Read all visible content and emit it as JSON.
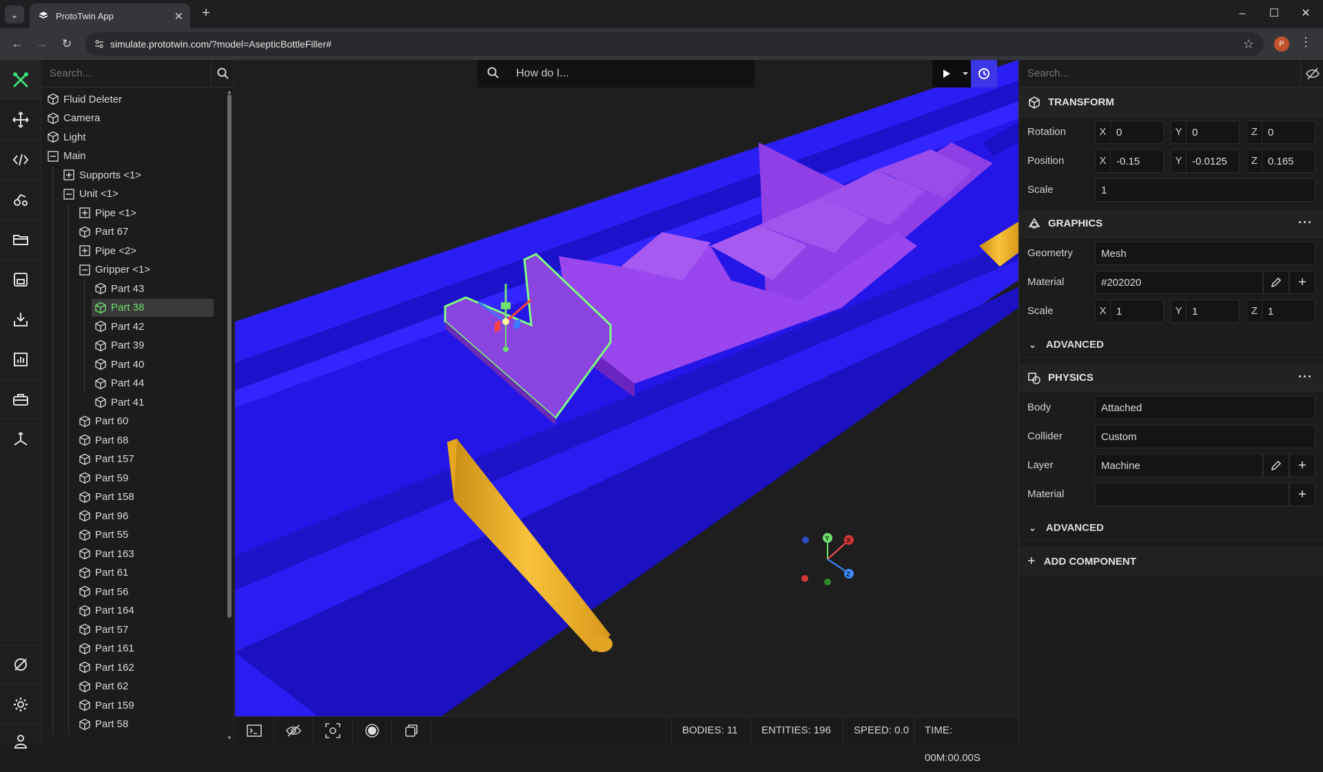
{
  "browser": {
    "tab_title": "ProtoTwin App",
    "url": "simulate.prototwin.com/?model=AsepticBottleFiller#",
    "profile_initial": "P"
  },
  "hierarchy": {
    "search_placeholder": "Search...",
    "items": [
      {
        "label": "Fluid Deleter",
        "level": 0,
        "icon": "cube-icon"
      },
      {
        "label": "Camera",
        "level": 0,
        "icon": "cube-icon"
      },
      {
        "label": "Light",
        "level": 0,
        "icon": "cube-icon"
      },
      {
        "label": "Main",
        "level": 0,
        "icon": "collapse-icon"
      },
      {
        "label": "Supports <1>",
        "level": 1,
        "icon": "expand-icon"
      },
      {
        "label": "Unit <1>",
        "level": 1,
        "icon": "collapse-icon"
      },
      {
        "label": "Pipe <1>",
        "level": 2,
        "icon": "expand-icon"
      },
      {
        "label": "Part 67",
        "level": 2,
        "icon": "cube-icon"
      },
      {
        "label": "Pipe <2>",
        "level": 2,
        "icon": "expand-icon"
      },
      {
        "label": "Gripper <1>",
        "level": 2,
        "icon": "collapse-icon"
      },
      {
        "label": "Part 43",
        "level": 3,
        "icon": "cube-icon"
      },
      {
        "label": "Part 38",
        "level": 3,
        "icon": "cube-icon",
        "selected": true
      },
      {
        "label": "Part 42",
        "level": 3,
        "icon": "cube-icon"
      },
      {
        "label": "Part 39",
        "level": 3,
        "icon": "cube-icon"
      },
      {
        "label": "Part 40",
        "level": 3,
        "icon": "cube-icon"
      },
      {
        "label": "Part 44",
        "level": 3,
        "icon": "cube-icon"
      },
      {
        "label": "Part 41",
        "level": 3,
        "icon": "cube-icon"
      },
      {
        "label": "Part 60",
        "level": 2,
        "icon": "cube-icon"
      },
      {
        "label": "Part 68",
        "level": 2,
        "icon": "cube-icon"
      },
      {
        "label": "Part 157",
        "level": 2,
        "icon": "cube-icon"
      },
      {
        "label": "Part 59",
        "level": 2,
        "icon": "cube-icon"
      },
      {
        "label": "Part 158",
        "level": 2,
        "icon": "cube-icon"
      },
      {
        "label": "Part 96",
        "level": 2,
        "icon": "cube-icon"
      },
      {
        "label": "Part 55",
        "level": 2,
        "icon": "cube-icon"
      },
      {
        "label": "Part 163",
        "level": 2,
        "icon": "cube-icon"
      },
      {
        "label": "Part 61",
        "level": 2,
        "icon": "cube-icon"
      },
      {
        "label": "Part 56",
        "level": 2,
        "icon": "cube-icon"
      },
      {
        "label": "Part 164",
        "level": 2,
        "icon": "cube-icon"
      },
      {
        "label": "Part 57",
        "level": 2,
        "icon": "cube-icon"
      },
      {
        "label": "Part 161",
        "level": 2,
        "icon": "cube-icon"
      },
      {
        "label": "Part 162",
        "level": 2,
        "icon": "cube-icon"
      },
      {
        "label": "Part 62",
        "level": 2,
        "icon": "cube-icon"
      },
      {
        "label": "Part 159",
        "level": 2,
        "icon": "cube-icon"
      },
      {
        "label": "Part 58",
        "level": 2,
        "icon": "cube-icon"
      }
    ]
  },
  "viewport": {
    "search_placeholder": "How do I...",
    "status": {
      "bodies": "BODIES: 11",
      "entities": "ENTITIES: 196",
      "speed": "SPEED: 0.0",
      "time": "TIME: 00M:00.00S"
    },
    "gizmo_labels": {
      "x": "X",
      "y": "Y",
      "z": "Z"
    }
  },
  "inspector": {
    "search_placeholder": "Search...",
    "transform": {
      "title": "TRANSFORM",
      "rotation_label": "Rotation",
      "rotation": {
        "x": "0",
        "y": "0",
        "z": "0"
      },
      "position_label": "Position",
      "position": {
        "x": "-0.15",
        "y": "-0.0125",
        "z": "0.165"
      },
      "scale_label": "Scale",
      "scale": "1"
    },
    "graphics": {
      "title": "GRAPHICS",
      "geometry_label": "Geometry",
      "geometry": "Mesh",
      "material_label": "Material",
      "material": "#202020",
      "scale_label": "Scale",
      "scale": {
        "x": "1",
        "y": "1",
        "z": "1"
      },
      "advanced": "ADVANCED"
    },
    "physics": {
      "title": "PHYSICS",
      "body_label": "Body",
      "body": "Attached",
      "collider_label": "Collider",
      "collider": "Custom",
      "layer_label": "Layer",
      "layer": "Machine",
      "material_label": "Material",
      "material": "",
      "advanced": "ADVANCED"
    },
    "add_component": "ADD COMPONENT"
  },
  "axis_letters": {
    "x": "X",
    "y": "Y",
    "z": "Z"
  },
  "colors": {
    "accent_green": "#6fe16f",
    "conveyor_blue": "#2a1cf0",
    "gripper_purple": "#8f3be8",
    "pipe_yellow": "#f3b72a"
  }
}
